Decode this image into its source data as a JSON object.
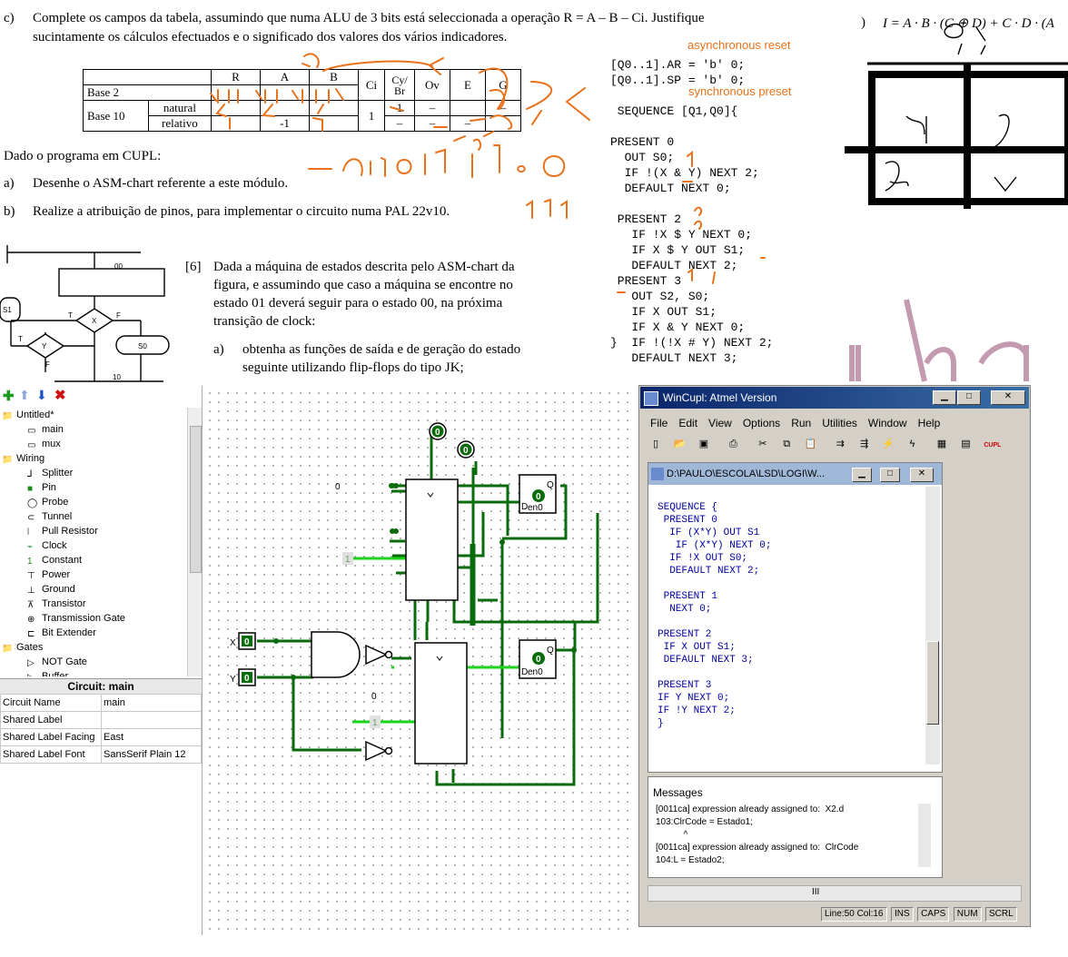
{
  "doc": {
    "q_c_label": "c)",
    "q_c_line1": "Complete os campos da tabela, assumindo que numa ALU de 3 bits está seleccionada a operação R = A – B – Ci. Justifique",
    "q_c_line2": "sucintamente os cálculos efectuados e o significado dos valores dos vários indicadores.",
    "table_headers": [
      "",
      "",
      "R",
      "A",
      "B",
      "Ci",
      "Cy/ Br",
      "Ov",
      "E",
      "G"
    ],
    "row_base2": "Base 2",
    "row_base10": "Base 10",
    "row_natural": "natural",
    "row_relativo": "relativo",
    "cell_a_relativo": "-1",
    "cell_ci": "1",
    "cell_cy_natural": "1",
    "dash": "–",
    "cupl_intro": "Dado o programa em CUPL:",
    "qa_label": "a)",
    "qa_text": "Desenhe o ASM-chart referente a este módulo.",
    "qb_label": "b)",
    "qb_text": "Realize a atribuição de pinos, para implementar o circuito numa PAL 22v10.",
    "q6_label": "[6]",
    "q6_line1": "Dada a máquina de estados descrita pelo ASM-chart da",
    "q6_line2": "figura, e assumindo que caso a máquina se encontre no",
    "q6_line3": "estado 01 deverá seguir para o estado 00, na próxima",
    "q6_line4": "transição de clock:",
    "q6a_label": "a)",
    "q6a_line1": "obtenha as funções de saída e de geração do estado",
    "q6a_line2": "seguinte utilizando flip-flops do tipo JK;",
    "cupl_code": "[Q0..1].AR = 'b' 0;\n[Q0..1].SP = 'b' 0;\n\n SEQUENCE [Q1,Q0]{\n\nPRESENT 0\n  OUT S0;\n  IF !(X & Y) NEXT 2;\n  DEFAULT NEXT 0;\n\n PRESENT 2\n   IF !X $ Y NEXT 0;\n   IF X $ Y OUT S1;\n   DEFAULT NEXT 2;\n PRESENT 3\n   OUT S2, S0;\n   IF X OUT S1;\n   IF X & Y NEXT 0;\n}  IF !(!X # Y) NEXT 2;\n   DEFAULT NEXT 3;",
    "annot_async": "asynchronous reset",
    "annot_sync": "synchronous preset",
    "formula_label": ")",
    "formula": "I = A · B · (C ⊕ D) + C · D · (A",
    "asm_labels": {
      "s1": "S1",
      "s0": "S0",
      "x": "X",
      "y": "Y",
      "t": "T",
      "f": "F",
      "s00": "00",
      "s10": "10"
    }
  },
  "logisim": {
    "toolbar_icons": [
      "add-icon",
      "up-icon",
      "down-icon",
      "delete-icon"
    ],
    "tree": [
      {
        "label": "Untitled*",
        "indent": 0,
        "icon": "folder"
      },
      {
        "label": "main",
        "indent": 1,
        "icon": "circuit"
      },
      {
        "label": "mux",
        "indent": 1,
        "icon": "circuit"
      },
      {
        "label": "Wiring",
        "indent": 0,
        "icon": "folder"
      },
      {
        "label": "Splitter",
        "indent": 1,
        "icon": "splitter"
      },
      {
        "label": "Pin",
        "indent": 1,
        "icon": "pin"
      },
      {
        "label": "Probe",
        "indent": 1,
        "icon": "probe"
      },
      {
        "label": "Tunnel",
        "indent": 1,
        "icon": "tunnel"
      },
      {
        "label": "Pull Resistor",
        "indent": 1,
        "icon": "resistor"
      },
      {
        "label": "Clock",
        "indent": 1,
        "icon": "clock"
      },
      {
        "label": "Constant",
        "indent": 1,
        "icon": "constant"
      },
      {
        "label": "Power",
        "indent": 1,
        "icon": "power"
      },
      {
        "label": "Ground",
        "indent": 1,
        "icon": "ground"
      },
      {
        "label": "Transistor",
        "indent": 1,
        "icon": "transistor"
      },
      {
        "label": "Transmission Gate",
        "indent": 1,
        "icon": "tgate"
      },
      {
        "label": "Bit Extender",
        "indent": 1,
        "icon": "extender"
      },
      {
        "label": "Gates",
        "indent": 0,
        "icon": "folder"
      },
      {
        "label": "NOT Gate",
        "indent": 1,
        "icon": "not"
      },
      {
        "label": "Buffer",
        "indent": 1,
        "icon": "buffer"
      }
    ],
    "props_title": "Circuit: main",
    "props": [
      {
        "key": "Circuit Name",
        "value": "main"
      },
      {
        "key": "Shared Label",
        "value": ""
      },
      {
        "key": "Shared Label Facing",
        "value": "East"
      },
      {
        "key": "Shared Label Font",
        "value": "SansSerif Plain 12"
      }
    ],
    "canvas": {
      "pin_x_label": "X",
      "pin_y_label": "Y",
      "pin_value": "0",
      "const_0": "0",
      "const_1": "1",
      "probe_value": "0",
      "ff_label": "en0",
      "ff_q": "Q",
      "ff_d": "D"
    }
  },
  "wincupl": {
    "title": "WinCupl:  Atmel Version",
    "menu": [
      "File",
      "Edit",
      "View",
      "Options",
      "Run",
      "Utilities",
      "Window",
      "Help"
    ],
    "child_title": "D:\\PAULO\\ESCOLA\\LSD\\LOGI\\W...",
    "code": "\nSEQUENCE {\n PRESENT 0\n  IF (X*Y) OUT S1\n   IF (X*Y) NEXT 0;\n  IF !X OUT S0;\n  DEFAULT NEXT 2;\n\n PRESENT 1\n  NEXT 0;\n\nPRESENT 2\n IF X OUT S1;\n DEFAULT NEXT 3;\n\nPRESENT 3\nIF Y NEXT 0;\nIF !Y NEXT 2;\n}",
    "messages_title": "Messages",
    "messages": "[0011ca] expression already assigned to:  X2.d\n103:ClrCode = Estado1;\n           ^\n[0011ca] expression already assigned to:  ClrCode\n104:L = Estado2;",
    "scroll_grip": "III",
    "status": {
      "pos": "Line:50 Col:16",
      "ins": "INS",
      "caps": "CAPS",
      "num": "NUM",
      "scrl": "SCRL"
    },
    "cupl_btn": "CUPL"
  }
}
